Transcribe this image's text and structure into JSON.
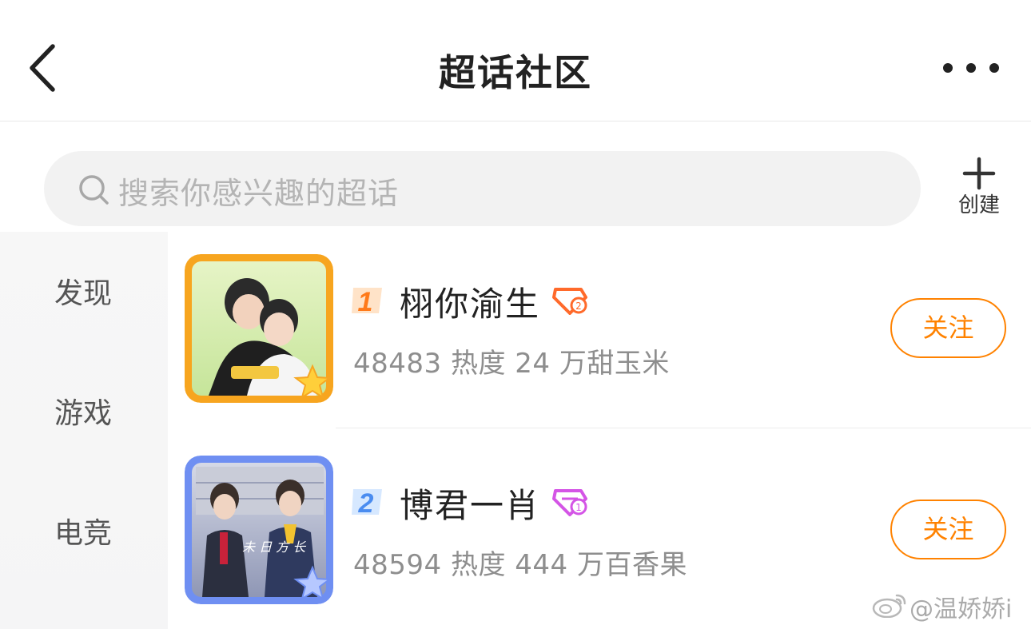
{
  "header": {
    "title": "超话社区",
    "back_icon": "chevron-left-icon",
    "more_icon": "more-dots-icon"
  },
  "search": {
    "placeholder": "搜索你感兴趣的超话",
    "icon": "search-icon"
  },
  "create": {
    "label": "创建",
    "icon": "plus-icon"
  },
  "sidebar": {
    "items": [
      {
        "label": "发现"
      },
      {
        "label": "游戏"
      },
      {
        "label": "电竞"
      }
    ]
  },
  "topics": [
    {
      "rank": "1",
      "name": "栩你渝生",
      "stats": "48483 热度  24 万甜玉米",
      "follow_label": "关注",
      "badge_color": "#ff6a2b",
      "frame_color": "#f9a623"
    },
    {
      "rank": "2",
      "name": "博君一肖",
      "stats": "48594 热度  444 万百香果",
      "follow_label": "关注",
      "badge_color": "#d455e6",
      "frame_color": "#6f8ff2"
    }
  ],
  "watermark": {
    "text": "@温娇娇i"
  },
  "colors": {
    "accent": "#ff8200",
    "rank1": "#ff7a1a",
    "rank2": "#4a8cf0"
  }
}
